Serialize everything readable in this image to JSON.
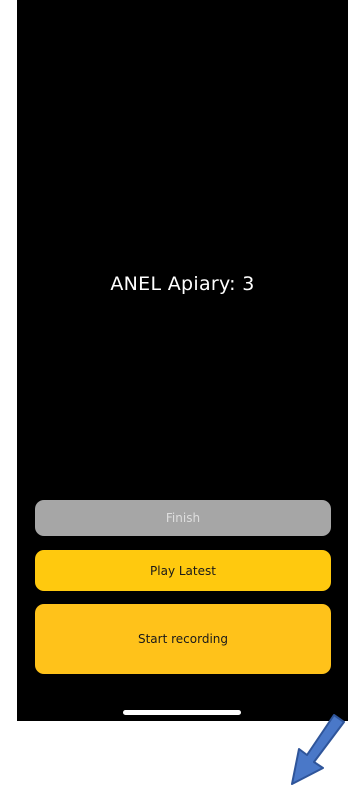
{
  "app": {
    "title": "ANEL Apiary: 3"
  },
  "buttons": {
    "finish_label": "Finish",
    "play_latest_label": "Play Latest",
    "start_recording_label": "Start recording"
  },
  "colors": {
    "background": "#000000",
    "finish_button": "#a6a6a6",
    "primary_button": "#ffc90e",
    "annotation_arrow": "#4a78c8"
  },
  "icons": {
    "annotation": "arrow-down-left-icon"
  }
}
